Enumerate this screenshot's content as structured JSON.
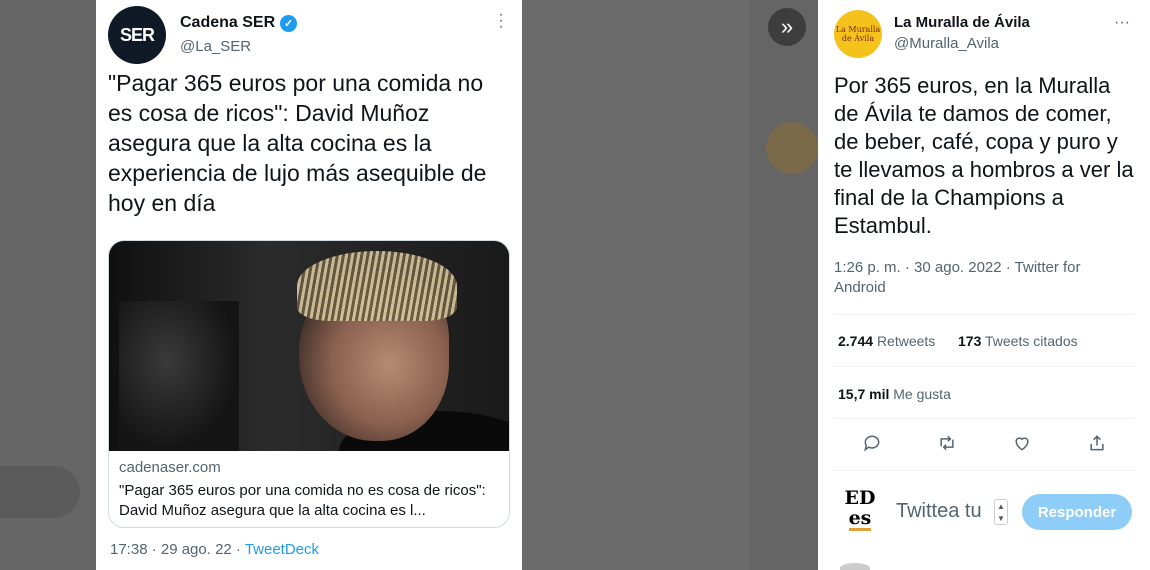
{
  "left_tweet": {
    "author_name": "Cadena SER",
    "author_handle": "@La_SER",
    "avatar_text": "SER",
    "text": "\"Pagar 365 euros por una comida no es cosa de ricos\": David Muñoz asegura que la alta cocina es la experiencia de lujo más asequible de hoy en día",
    "link_card": {
      "domain": "cadenaser.com",
      "title": "\"Pagar 365 euros por una comida no es cosa de ricos\": David Muñoz asegura que la alta cocina es l..."
    },
    "time": "17:38 · 29 ago. 22 · ",
    "source": "TweetDeck"
  },
  "right_tweet": {
    "author_name": "La Muralla de Ávila",
    "author_handle": "@Muralla_Avila",
    "avatar_line1": "La Muralla",
    "avatar_line2": "de Ávila",
    "text": "Por 365 euros, en la Muralla de Ávila te damos de comer, de beber, café, copa y puro y te llevamos a hombros a ver la final de la Champions a Estambul.",
    "meta": "1:26 p. m. · 30 ago. 2022 · Twitter for Android",
    "retweets_count": "2.744",
    "retweets_label": "Retweets",
    "quotes_count": "173",
    "quotes_label": "Tweets citados",
    "likes_count": "15,7 mil",
    "likes_label": "Me gusta",
    "actions": [
      "reply-icon",
      "retweet-icon",
      "like-icon",
      "share-icon"
    ]
  },
  "reply_box": {
    "logo_top": "ED",
    "logo_bottom": "es",
    "placeholder": "Twittea tu",
    "button_label": "Responder"
  },
  "colors": {
    "accent": "#1d9bf0",
    "reply_button": "#8ecdf8",
    "muted_text": "#536471"
  }
}
